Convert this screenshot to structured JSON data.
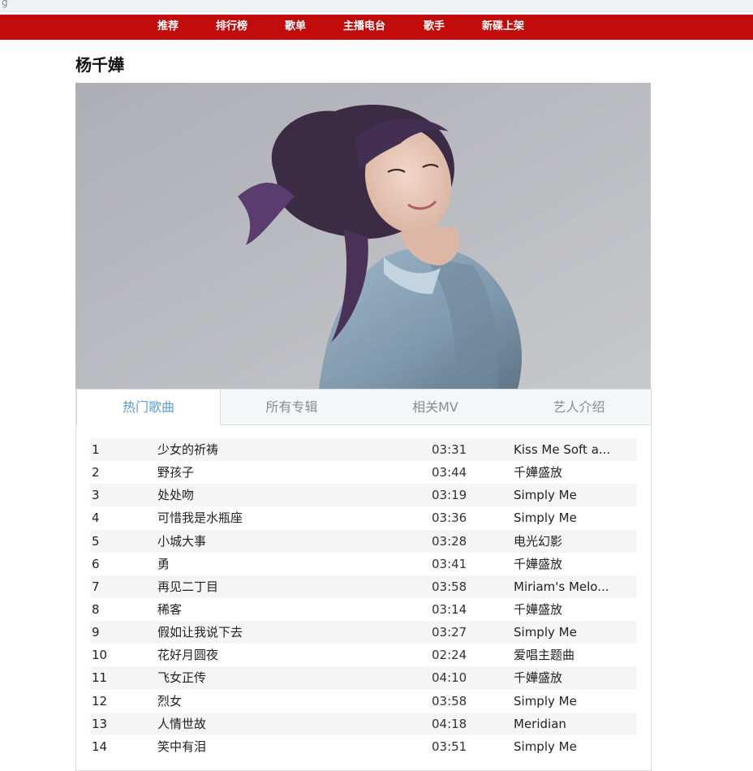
{
  "browser": {
    "corner_mark": "g"
  },
  "nav": {
    "items": [
      "推荐",
      "排行榜",
      "歌单",
      "主播电台",
      "歌手",
      "新碟上架"
    ]
  },
  "artist": {
    "name": "杨千嬅"
  },
  "tabs": [
    {
      "label": "热门歌曲",
      "active": true
    },
    {
      "label": "所有专辑",
      "active": false
    },
    {
      "label": "相关MV",
      "active": false
    },
    {
      "label": "艺人介绍",
      "active": false
    }
  ],
  "songs": [
    {
      "index": "1",
      "title": "少女的祈祷",
      "duration": "03:31",
      "album": "Kiss Me Soft a..."
    },
    {
      "index": "2",
      "title": "野孩子",
      "duration": "03:44",
      "album": "千嬅盛放"
    },
    {
      "index": "3",
      "title": "处处吻",
      "duration": "03:19",
      "album": "Simply Me"
    },
    {
      "index": "4",
      "title": "可惜我是水瓶座",
      "duration": "03:36",
      "album": "Simply Me"
    },
    {
      "index": "5",
      "title": "小城大事",
      "duration": "03:28",
      "album": "电光幻影"
    },
    {
      "index": "6",
      "title": "勇",
      "duration": "03:41",
      "album": "千嬅盛放"
    },
    {
      "index": "7",
      "title": "再见二丁目",
      "duration": "03:58",
      "album": "Miriam's Melo..."
    },
    {
      "index": "8",
      "title": "稀客",
      "duration": "03:14",
      "album": "千嬅盛放"
    },
    {
      "index": "9",
      "title": "假如让我说下去",
      "duration": "03:27",
      "album": "Simply Me"
    },
    {
      "index": "10",
      "title": "花好月圆夜",
      "duration": "02:24",
      "album": "爱唱主题曲"
    },
    {
      "index": "11",
      "title": "飞女正传",
      "duration": "04:10",
      "album": "千嬅盛放"
    },
    {
      "index": "12",
      "title": "烈女",
      "duration": "03:58",
      "album": "Simply Me"
    },
    {
      "index": "13",
      "title": "人情世故",
      "duration": "04:18",
      "album": "Meridian"
    },
    {
      "index": "14",
      "title": "笑中有泪",
      "duration": "03:51",
      "album": "Simply Me"
    }
  ],
  "theme": {
    "nav_red": "#c20c0c",
    "tab_active_blue": "#5b9bd5"
  }
}
